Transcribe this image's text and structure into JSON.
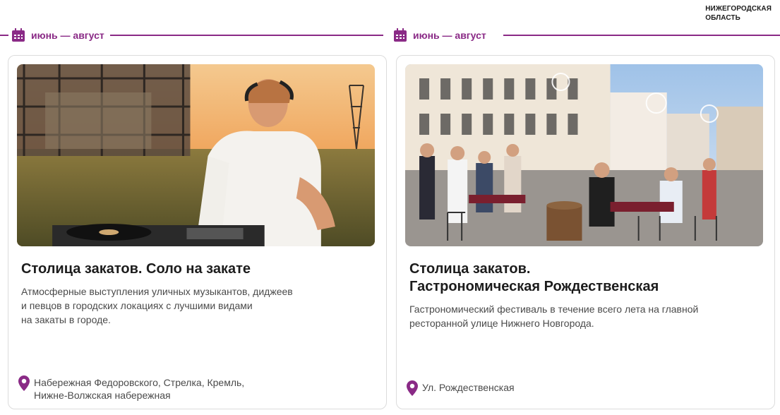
{
  "header": {
    "region": "НИЖЕГОРОДСКАЯ\nОБЛАСТЬ"
  },
  "colors": {
    "accent": "#8a2a86",
    "pin": "#8a2a86"
  },
  "cards": [
    {
      "date": "июнь — август",
      "title": "Столица закатов. Соло на закате",
      "description": "Атмосферные выступления уличных музыкантов, диджеев\nи певцов в городских локациях с лучшими видами\nна закаты в городе.",
      "location": "Набережная Федоровского, Стрелка, Кремль,\nНижне-Волжская набережная",
      "image_icon": "dj-sunset-photo"
    },
    {
      "date": "июнь — август",
      "title": "Столица закатов.\nГастрономическая Рождественская",
      "description": "Гастрономический фестиваль в течение всего лета на главной\nресторанной улице Нижнего Новгорода.",
      "location": "Ул. Рождественская",
      "image_icon": "street-festival-photo"
    }
  ]
}
